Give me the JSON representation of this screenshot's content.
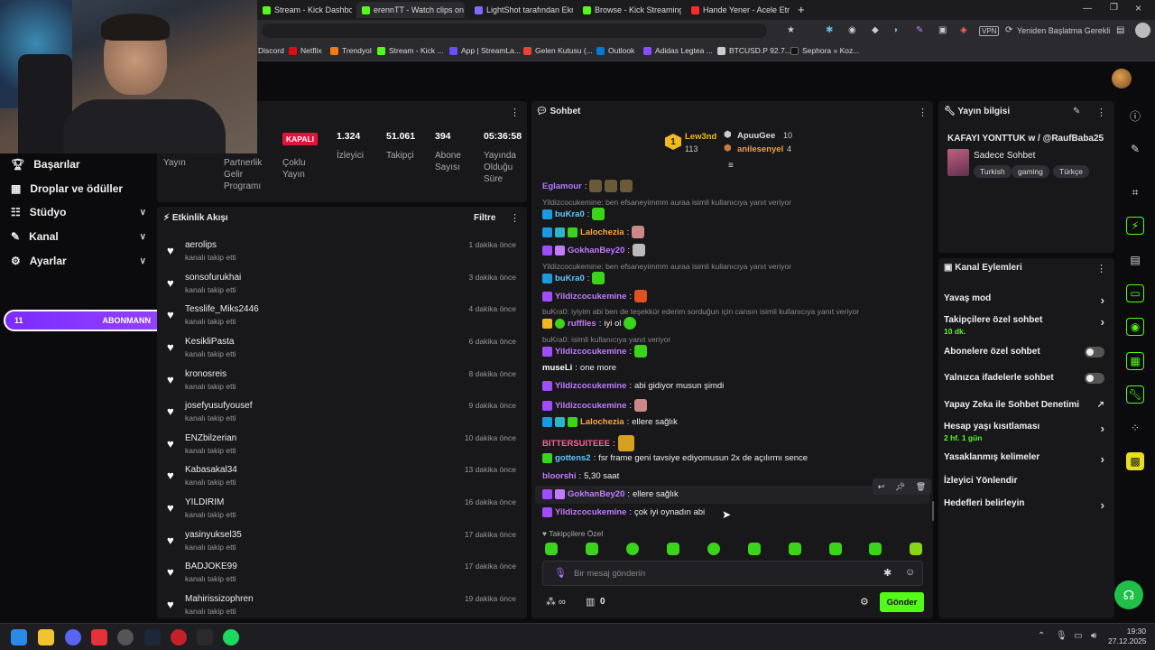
{
  "browser": {
    "tabs": [
      {
        "label": "Stream - Kick Dashboard",
        "color": "#53fc18"
      },
      {
        "label": "erennTT - Watch clips on K",
        "color": "#53fc18"
      },
      {
        "label": "LightShot tarafından Ekran",
        "color": "#7b6cff"
      },
      {
        "label": "Browse - Kick Streaming",
        "color": "#53fc18"
      },
      {
        "label": "Hande Yener - Acele Etme",
        "color": "#ff2b2b"
      }
    ],
    "restart_label": "Yeniden Başlatma Gerekli",
    "bookmarks": [
      {
        "label": "Discord",
        "color": "#5865f2"
      },
      {
        "label": "Netflix",
        "color": "#e50914"
      },
      {
        "label": "Trendyol",
        "color": "#f27a1a"
      },
      {
        "label": "Stream - Kick ...",
        "color": "#53fc18"
      },
      {
        "label": "App | StreamLa...",
        "color": "#6b4cff"
      },
      {
        "label": "Gelen Kutusu (...",
        "color": "#ea4335"
      },
      {
        "label": "Outlook",
        "color": "#0078d4"
      },
      {
        "label": "Adidas Legtea ...",
        "color": "#8a4cff"
      },
      {
        "label": "BTCUSD.P 92.7...",
        "color": "#cccccc"
      },
      {
        "label": "Sephora » Koz...",
        "color": "#111111"
      }
    ]
  },
  "sidebar": {
    "items": [
      {
        "label": "Başarılar",
        "icon": "trophy-icon",
        "has_chevron": false
      },
      {
        "label": "Droplar ve ödüller",
        "icon": "gift-icon",
        "has_chevron": false
      },
      {
        "label": "Stüdyo",
        "icon": "sliders-icon",
        "has_chevron": true
      },
      {
        "label": "Kanal",
        "icon": "pen-icon",
        "has_chevron": true
      },
      {
        "label": "Ayarlar",
        "icon": "gear-icon",
        "has_chevron": true
      }
    ],
    "goal": {
      "left": "11",
      "label": "ABONMANN",
      "right": "10"
    }
  },
  "stats": {
    "status_badge": "KAPALI",
    "items": [
      {
        "value": "",
        "label": "Yayın"
      },
      {
        "value": "",
        "label": "Partnerlik Gelir Programı"
      },
      {
        "value": "",
        "label": "Çoklu Yayın"
      },
      {
        "value": "1.324",
        "label": "İzleyici"
      },
      {
        "value": "51.061",
        "label": "Takipçi"
      },
      {
        "value": "394",
        "label": "Abone Sayısı"
      },
      {
        "value": "05:36:58",
        "label": "Yayında Olduğu Süre"
      }
    ]
  },
  "activity": {
    "title": "Etkinlik Akışı",
    "filter_label": "Filtre",
    "rows": [
      {
        "name": "aerolips",
        "sub": "kanalı takip etti",
        "time": "1 dakika önce"
      },
      {
        "name": "sonsofurukhai",
        "sub": "kanalı takip etti",
        "time": "3 dakika önce"
      },
      {
        "name": "Tesslife_Miks2446",
        "sub": "kanalı takip etti",
        "time": "4 dakika önce"
      },
      {
        "name": "KesikliPasta",
        "sub": "kanalı takip etti",
        "time": "6 dakika önce"
      },
      {
        "name": "kronosreis",
        "sub": "kanalı takip etti",
        "time": "8 dakika önce"
      },
      {
        "name": "josefyusufyousef",
        "sub": "kanalı takip etti",
        "time": "9 dakika önce"
      },
      {
        "name": "ENZbilzerian",
        "sub": "kanalı takip etti",
        "time": "10 dakika önce"
      },
      {
        "name": "Kabasakal34",
        "sub": "kanalı takip etti",
        "time": "13 dakika önce"
      },
      {
        "name": "YILDIRIM",
        "sub": "kanalı takip etti",
        "time": "16 dakika önce"
      },
      {
        "name": "yasinyuksel35",
        "sub": "kanalı takip etti",
        "time": "17 dakika önce"
      },
      {
        "name": "BADJOKE99",
        "sub": "kanalı takip etti",
        "time": "17 dakika önce"
      },
      {
        "name": "Mahirissizophren",
        "sub": "kanalı takip etti",
        "time": "19 dakika önce"
      }
    ]
  },
  "chat": {
    "title": "Sohbet",
    "leaderboard": [
      {
        "rank": "1",
        "name": "Lew3nd",
        "count": "113"
      },
      {
        "name": "ApuuGee",
        "count": "10"
      },
      {
        "name": "anilesenyel",
        "count": "4"
      }
    ],
    "messages": [
      {
        "type": "msg",
        "user": "Eglamour",
        "color": "#b07cff",
        "text": ""
      },
      {
        "type": "reply",
        "text": "Yildizcocukemine: ben efsaneyimmm auraa isimli kullanıcıya yanıt veriyor"
      },
      {
        "type": "msg",
        "user": "buKra0",
        "color": "#5ec8ff",
        "text": ""
      },
      {
        "type": "msg",
        "user": "Lalochezia",
        "color": "#ffa53d",
        "text": ""
      },
      {
        "type": "msg",
        "user": "GokhanBey20",
        "color": "#c07cff",
        "text": ""
      },
      {
        "type": "reply",
        "text": "Yildizcocukemine: ben efsaneyimmm auraa isimli kullanıcıya yanıt veriyor"
      },
      {
        "type": "msg",
        "user": "buKra0",
        "color": "#5ec8ff",
        "text": ""
      },
      {
        "type": "msg",
        "user": "Yildizcocukemine",
        "color": "#c07cff",
        "text": ""
      },
      {
        "type": "reply",
        "text": "buKra0: iyiyim abi ben de teşekkür ederim sorduğun için cansın isimli kullanıcıya yanıt veriyor"
      },
      {
        "type": "msg",
        "user": "rufflles",
        "color": "#c07cff",
        "text": "iyi ol"
      },
      {
        "type": "reply",
        "text": "buKra0: isimli kullanıcıya yanıt veriyor"
      },
      {
        "type": "msg",
        "user": "Yildizcocukemine",
        "color": "#c07cff",
        "text": ""
      },
      {
        "type": "msg",
        "user": "museLi",
        "color": "#ffffff",
        "text": "one more"
      },
      {
        "type": "msg",
        "user": "Yildizcocukemine",
        "color": "#c07cff",
        "text": "abi gidiyor musun şimdi"
      },
      {
        "type": "msg",
        "user": "Yildizcocukemine",
        "color": "#c07cff",
        "text": ""
      },
      {
        "type": "msg",
        "user": "Lalochezia",
        "color": "#ffa53d",
        "text": "ellere sağlık"
      },
      {
        "type": "msg",
        "user": "BITTERSUITEEE",
        "color": "#ff5f9e",
        "text": ""
      },
      {
        "type": "msg",
        "user": "gottens2",
        "color": "#5ec8ff",
        "text": "fsr frame geni tavsiye ediyomusun 2x de açılırmı sence"
      },
      {
        "type": "msg",
        "user": "bloorshi",
        "color": "#c07cff",
        "text": "5,30 saat"
      },
      {
        "type": "msg",
        "user": "GokhanBey20",
        "color": "#c07cff",
        "text": "ellere sağlık"
      },
      {
        "type": "msg",
        "user": "Yildizcocukemine",
        "color": "#c07cff",
        "text": "çok iyi oynadın abi"
      }
    ],
    "followers_only_label": "Takipçilere Özel",
    "input_placeholder": "Bir mesaj gönderin",
    "points": "0",
    "send_label": "Gönder"
  },
  "stream_info": {
    "title": "Yayın bilgisi",
    "stream_title": "KAFAYI YONTTUK w / @RaufBaba25",
    "mode": "Sadece Sohbet",
    "tags": [
      "Turkish",
      "gaming",
      "Türkçe"
    ]
  },
  "channel_actions": {
    "title": "Kanal Eylemleri",
    "rows": [
      {
        "label": "Yavaş mod",
        "sub": "",
        "control": "arrow"
      },
      {
        "label": "Takipçilere özel sohbet",
        "sub": "10 dk.",
        "control": "arrow"
      },
      {
        "label": "Abonelere özel sohbet",
        "sub": "",
        "control": "toggle"
      },
      {
        "label": "Yalnızca ifadelerle sohbet",
        "sub": "",
        "control": "toggle"
      },
      {
        "label": "Yapay Zeka ile Sohbet Denetimi",
        "sub": "",
        "control": "external"
      },
      {
        "label": "Hesap yaşı kısıtlaması",
        "sub": "2 hf. 1 gün",
        "control": "arrow"
      },
      {
        "label": "Yasaklanmış kelimeler",
        "sub": "",
        "control": "arrow"
      },
      {
        "label": "İzleyici Yönlendir",
        "sub": "",
        "control": "none"
      },
      {
        "label": "Hedefleri belirleyin",
        "sub": "",
        "control": "arrow"
      }
    ]
  },
  "taskbar": {
    "time": "19:30",
    "date": "27.12.2025"
  },
  "colors": {
    "accent": "#53fc18",
    "panel": "#18181b",
    "bg": "#0b0b0d",
    "danger": "#e3143c",
    "goal": "#7b2cff"
  }
}
